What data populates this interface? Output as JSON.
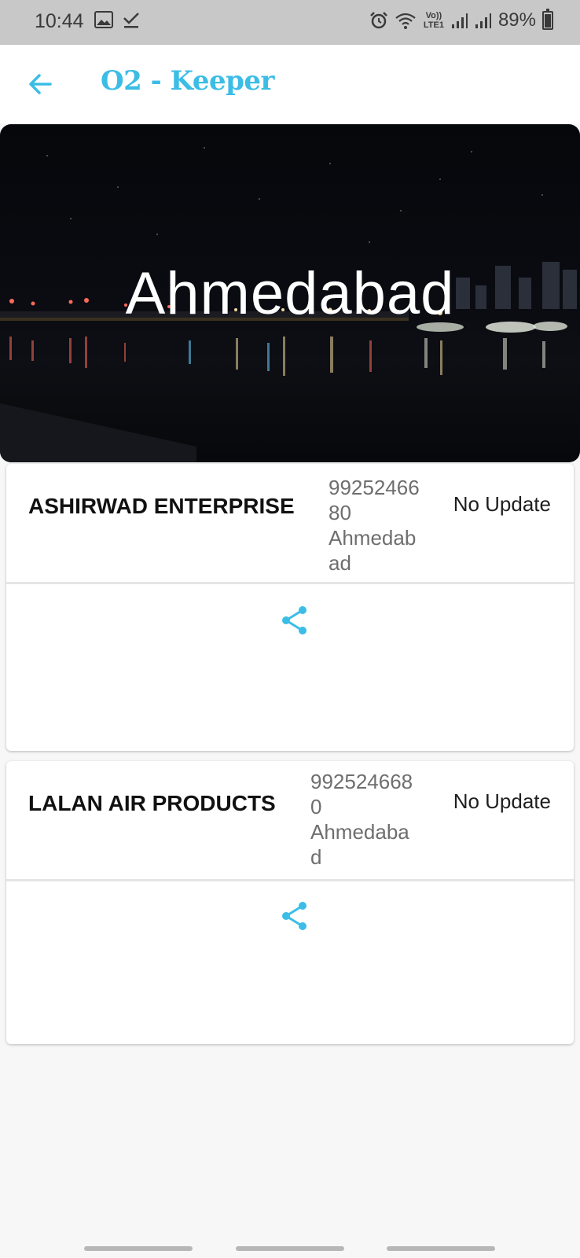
{
  "status_bar": {
    "time": "10:44",
    "signal_labels": "Vo)) LTE1",
    "battery": "89%"
  },
  "app_bar": {
    "title": "O2 - Keeper"
  },
  "hero": {
    "city": "Ahmedabad"
  },
  "cards": [
    {
      "company": "ASHIRWAD ENTERPRISE",
      "phone": "9925246680",
      "location": "Ahmedabad",
      "status": "No Update"
    },
    {
      "company": "LALAN AIR PRODUCTS",
      "phone": "9925246680",
      "location": "Ahmedabad",
      "status": "No Update"
    }
  ],
  "colors": {
    "accent": "#3bbde6",
    "status_bar": "#c8c8c8",
    "background": "#f7f7f7"
  }
}
